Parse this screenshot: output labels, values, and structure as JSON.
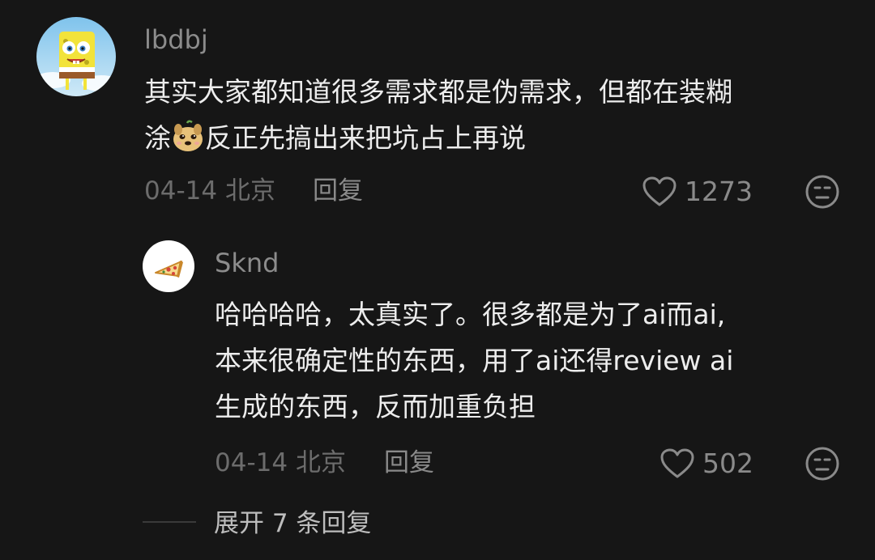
{
  "comment": {
    "username": "lbdbj",
    "text_line1": "其实大家都知道很多需求都是伪需求，但都在装糊",
    "text_line2_a": "涂",
    "text_line2_b": "反正先搞出来把坑占上再说",
    "date": "04-14",
    "location": "北京",
    "reply_label": "回复",
    "likes": "1273",
    "emoji_icon": "dog-face-emoji",
    "avatar_icon": "sponge-character-avatar"
  },
  "reply": {
    "username": "Sknd",
    "text_line1": "哈哈哈哈，太真实了。很多都是为了ai而ai,",
    "text_line2": "本来很确定性的东西，用了ai还得review ai",
    "text_line3": "生成的东西，反而加重负担",
    "date": "04-14",
    "location": "北京",
    "reply_label": "回复",
    "likes": "502",
    "avatar_icon": "pizza-slice-avatar"
  },
  "expand": {
    "label": "展开 7 条回复"
  },
  "colors": {
    "background": "#161616",
    "text_primary": "#ededed",
    "text_secondary": "#8c8c8c"
  }
}
